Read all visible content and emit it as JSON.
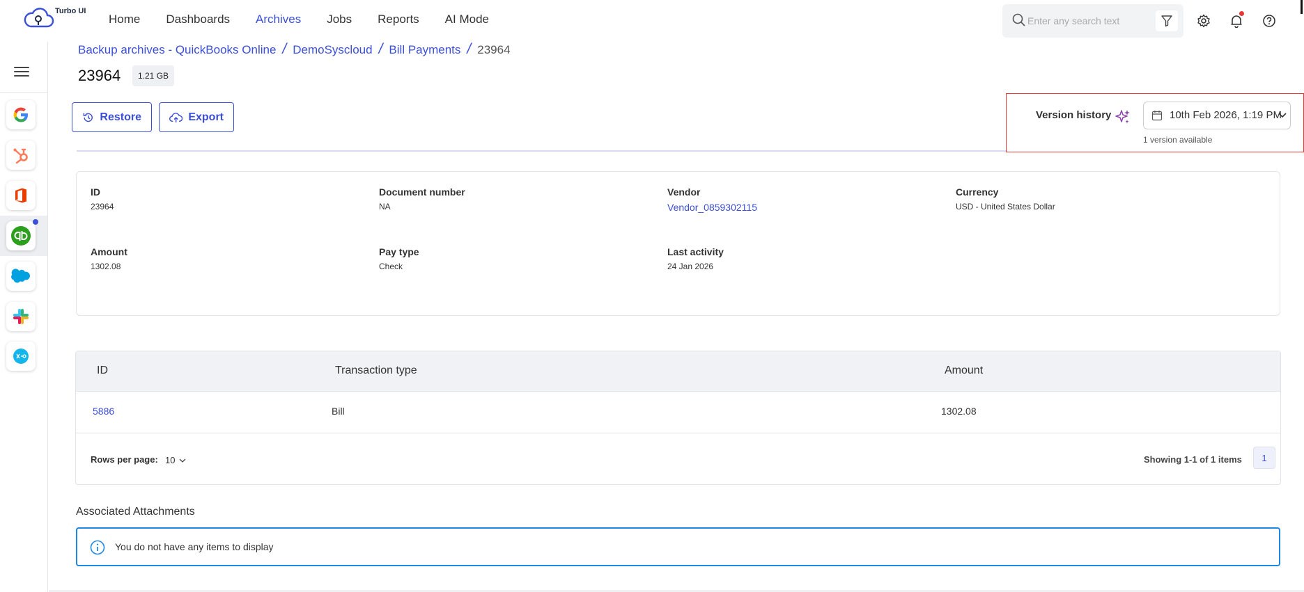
{
  "app": {
    "brand": "Turbo UI"
  },
  "nav": {
    "items": [
      "Home",
      "Dashboards",
      "Archives",
      "Jobs",
      "Reports",
      "AI Mode"
    ],
    "active": "Archives"
  },
  "search": {
    "placeholder": "Enter any search text"
  },
  "breadcrumb": {
    "items": [
      "Backup archives -  QuickBooks Online",
      "DemoSyscloud",
      "Bill Payments"
    ],
    "current": "23964"
  },
  "record": {
    "title": "23964",
    "size": "1.21 GB"
  },
  "actions": {
    "restore_label": "Restore",
    "export_label": "Export"
  },
  "version_history": {
    "label": "Version history",
    "selected": "10th Feb 2026, 1:19 PM",
    "note": "1 version available"
  },
  "details": {
    "fields": [
      {
        "label": "ID",
        "value": "23964"
      },
      {
        "label": "Document number",
        "value": "NA"
      },
      {
        "label": "Vendor",
        "value": "Vendor_0859302115"
      },
      {
        "label": "Currency",
        "value": "USD - United States Dollar"
      },
      {
        "label": "Amount",
        "value": "1302.08"
      },
      {
        "label": "Pay type",
        "value": "Check"
      },
      {
        "label": "Last activity",
        "value": "24 Jan 2026"
      }
    ]
  },
  "transactions": {
    "columns": [
      "ID",
      "Transaction type",
      "Amount"
    ],
    "rows": [
      {
        "id": "5886",
        "type": "Bill",
        "amount": "1302.08"
      }
    ],
    "rows_per_page_label": "Rows per page:",
    "rows_per_page": "10",
    "showing": "Showing 1-1 of 1 items",
    "page": "1"
  },
  "attachments": {
    "title": "Associated Attachments",
    "empty_message": "You do not have any items to display"
  },
  "apps": [
    "google",
    "hubspot",
    "office-365",
    "quickbooks",
    "salesforce",
    "slack",
    "xero"
  ],
  "colors": {
    "accent": "#3b4fd8",
    "highlight_border": "#e53935",
    "info_border": "#1e88e5"
  }
}
